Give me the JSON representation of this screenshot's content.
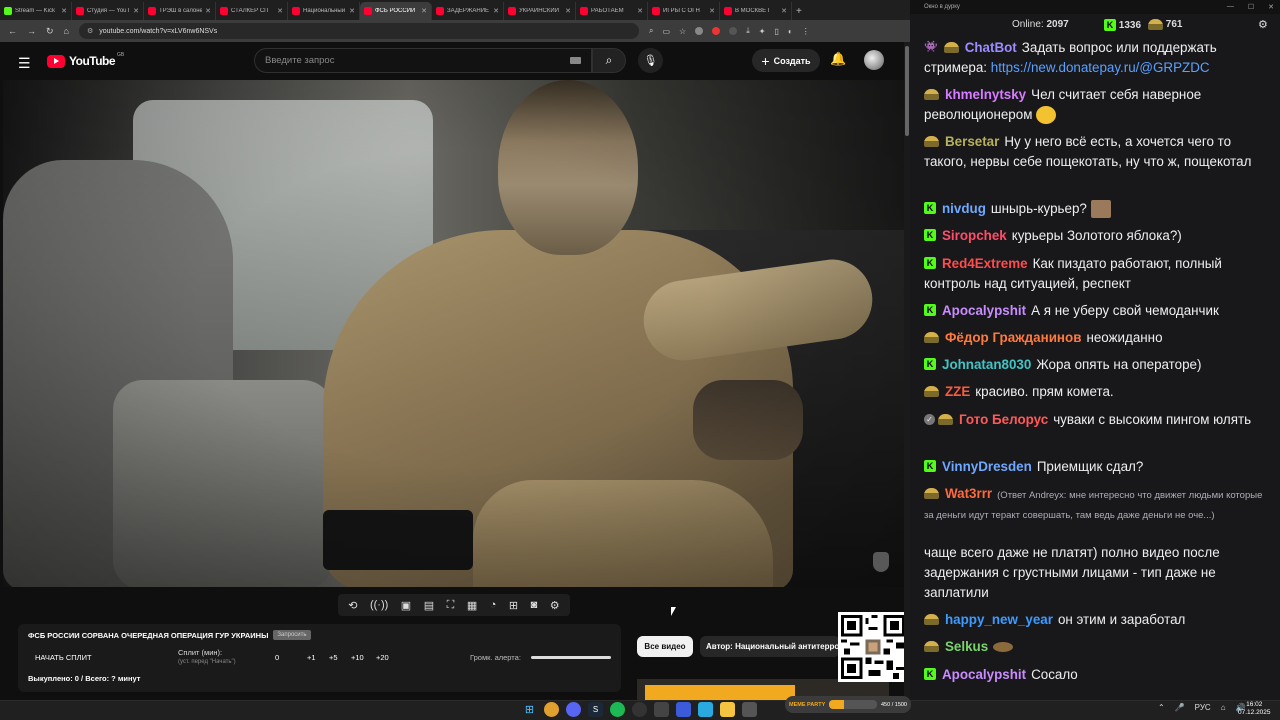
{
  "browser": {
    "tabs": [
      {
        "title": "Stream — Kick",
        "icon": "kick"
      },
      {
        "title": "Студия — YouTube",
        "icon": "youtube"
      },
      {
        "title": "ТРЭШ в салоне",
        "icon": "youtube"
      },
      {
        "title": "СТАЛКЕР СП",
        "icon": "youtube"
      },
      {
        "title": "Национальный",
        "icon": "youtube"
      },
      {
        "title": "ФСБ РОССИИ",
        "icon": "youtube",
        "active": true
      },
      {
        "title": "ЗАДЕРЖАНИЕ",
        "icon": "youtube"
      },
      {
        "title": "УКРАИНСКИЙ",
        "icon": "youtube"
      },
      {
        "title": "РАБОТАЕМ",
        "icon": "youtube"
      },
      {
        "title": "ИГРЫ С ОГН",
        "icon": "youtube"
      },
      {
        "title": "В МОСКВЕ Г",
        "icon": "youtube"
      }
    ],
    "url": "youtube.com/watch?v=xLV6nw6NSVs"
  },
  "youtube": {
    "logo_text": "YouTube",
    "logo_region": "GB",
    "search_placeholder": "Введите запрос",
    "create_label": "Создать"
  },
  "extension": {
    "title": "ФСБ РОССИИ СОРВАНА ОЧЕРЕДНАЯ ОПЕРАЦИЯ ГУР УКРАИНЫ",
    "remove_label": "Запросить",
    "start_split": "НАЧАТЬ СПЛИТ",
    "split_label": "Сплит (мин):",
    "split_sub": "(уст. перед \"Начать\")",
    "split_values": [
      "0",
      "+1",
      "+5",
      "+10",
      "+20"
    ],
    "alert_label": "Громк. алерта:",
    "bought": "Выкуплено: 0 / Всего: ? минут"
  },
  "related": {
    "all_videos": "Все видео",
    "author_chip": "Автор: Национальный антитеррористический комитет"
  },
  "meme_widget": {
    "label": "MEME PARTY",
    "progress": "450 / 1500"
  },
  "chat": {
    "window_title": "Окно в дурку",
    "online_label": "Online:",
    "online_count": "2097",
    "kick_count": "1336",
    "subs_count": "761",
    "messages": [
      {
        "user": "ChatBot",
        "color": "#9b8cff",
        "badge": "bot",
        "text": "Задать вопрос или поддержать стримера:",
        "link": "https://new.donatepay.ru/@GRPZDC"
      },
      {
        "user": "khmelnytsky",
        "color": "#d67cff",
        "badge": "hat",
        "text": "Чел считает себя наверное революционером"
      },
      {
        "user": "Bersetar",
        "color": "#b8b05a",
        "badge": "hat",
        "text": "Ну у него всё есть, а хочется чего то такого, нервы себе пощекотать, ну что ж, пощекотал"
      },
      {
        "user": "nivdug",
        "color": "#6fa8ff",
        "badge": "kick",
        "text": "шнырь-курьер?"
      },
      {
        "user": "Siropchek",
        "color": "#ff4d6a",
        "badge": "kick",
        "text": "курьеры Золотого яблока?)"
      },
      {
        "user": "Red4Extreme",
        "color": "#ff4d4d",
        "badge": "kick",
        "text": "Как пиздато работают, полный контроль над ситуацией, респект"
      },
      {
        "user": "Apocalypshit",
        "color": "#c98cff",
        "badge": "kick",
        "text": "А я не уберу свой чемоданчик"
      },
      {
        "user": "Фёдор Гражданинов",
        "color": "#ff7a3d",
        "badge": "hat",
        "text": "неожиданно"
      },
      {
        "user": "Johnatan8030",
        "color": "#40c4c4",
        "badge": "kick",
        "text": "Жора опять на операторе)"
      },
      {
        "user": "ZZE",
        "color": "#ff5a3d",
        "badge": "hat",
        "text": "красиво. прям комета."
      },
      {
        "user": "Гото Белорус",
        "color": "#ff5a5a",
        "badge": "check-hat",
        "text": "чуваки с высоким пингом юлять"
      },
      {
        "user": "VinnyDresden",
        "color": "#6fa8ff",
        "badge": "kick",
        "text": "Приемщик сдал?"
      },
      {
        "user": "Wat3rrr",
        "color": "#ff6a3d",
        "badge": "hat",
        "reply": "(Ответ Andreyx: мне интересно что движет людьми которые за деньги идут теракт совершать, там ведь даже деньги не оче...)",
        "text": "чаще всего даже не платят) полно видео после задержания с грустными лицами - тип даже не заплатили"
      },
      {
        "user": "happy_new_year",
        "color": "#3d9bff",
        "badge": "hat",
        "text": "он этим и заработал"
      },
      {
        "user": "Selkus",
        "color": "#7bd36b",
        "badge": "hat",
        "text": ""
      },
      {
        "user": "Apocalypshit",
        "color": "#c98cff",
        "badge": "kick",
        "text": "Сосало"
      }
    ]
  },
  "taskbar": {
    "lang": "РУС",
    "time": "16:02",
    "date": "07.12.2025"
  }
}
